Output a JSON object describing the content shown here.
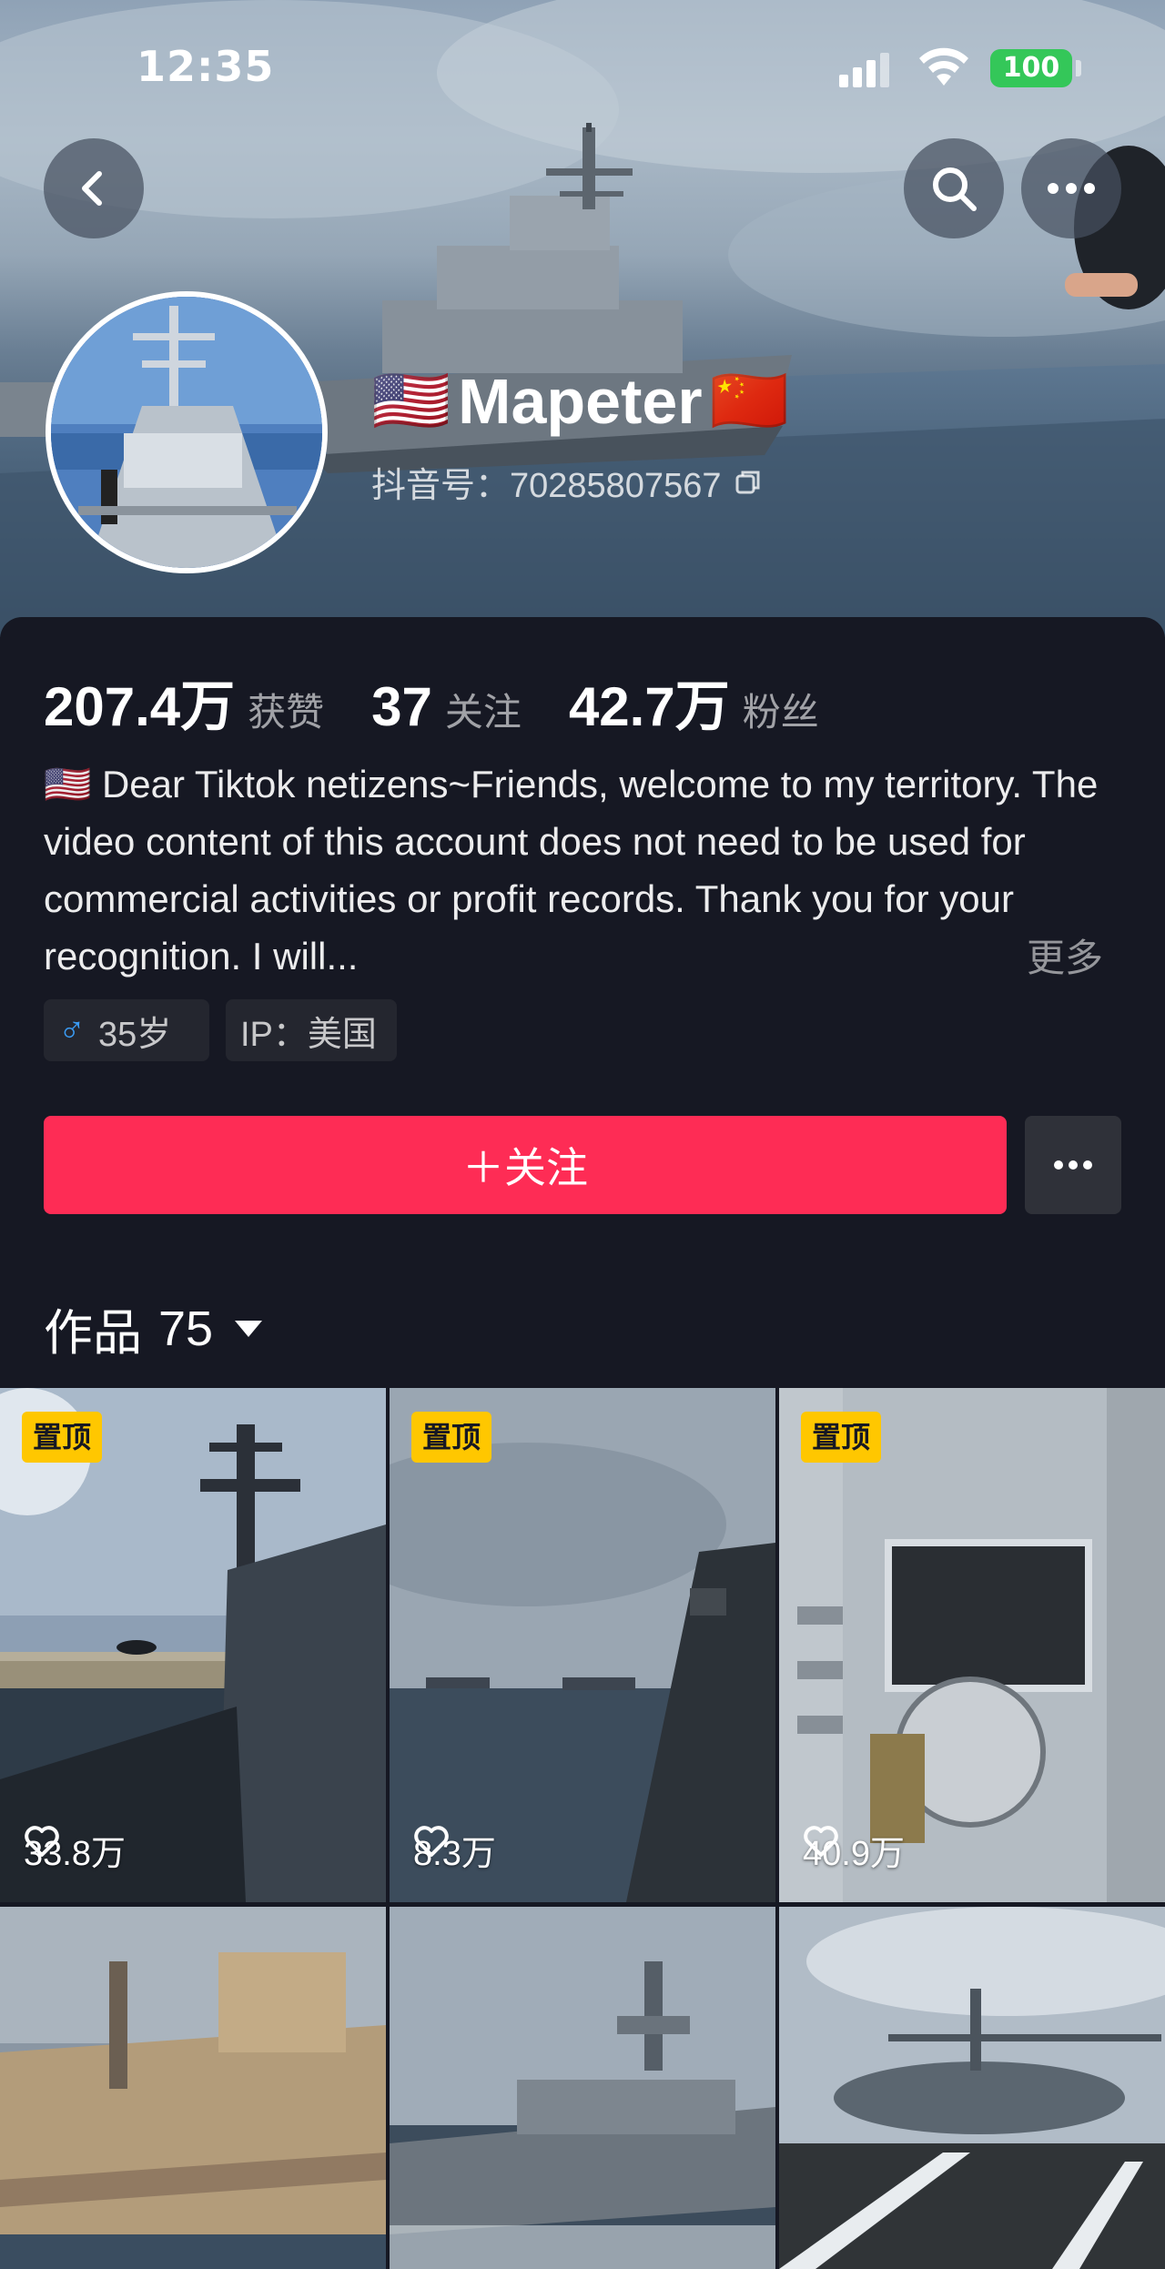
{
  "status_bar": {
    "time": "12:35",
    "battery": "100",
    "battery_color": "#34c759"
  },
  "header": {
    "back_icon": "chevron-left-icon",
    "search_icon": "search-icon",
    "more_icon": "ellipsis-icon"
  },
  "profile": {
    "flag_left": "🇺🇸",
    "name": "Mapeter",
    "flag_right": "🇨🇳",
    "douyin_id_label": "抖音号：70285807567",
    "copy_icon": "copy-icon"
  },
  "stats": [
    {
      "value": "207.4万",
      "label": "获赞"
    },
    {
      "value": "37",
      "label": "关注"
    },
    {
      "value": "42.7万",
      "label": "粉丝"
    }
  ],
  "bio": {
    "text": "🇺🇸 Dear Tiktok netizens~Friends, welcome to my territory. The video content of this account does not need to be used for commercial activities or profit records. Thank you for your recognition. I will...",
    "more": "更多"
  },
  "tags": {
    "age": "35岁",
    "male_icon": "♂",
    "ip": "IP：美国"
  },
  "actions": {
    "follow_label": "＋关注",
    "accent_color": "#fe2c55"
  },
  "works": {
    "label": "作品",
    "count": "75"
  },
  "videos": [
    {
      "pinned": "置顶",
      "likes": "33.8万"
    },
    {
      "pinned": "置顶",
      "likes": "8.3万"
    },
    {
      "pinned": "置顶",
      "likes": "40.9万"
    },
    {
      "pinned": "",
      "likes": ""
    },
    {
      "pinned": "",
      "likes": ""
    },
    {
      "pinned": "",
      "likes": ""
    }
  ],
  "pin_color": "#ffc700"
}
